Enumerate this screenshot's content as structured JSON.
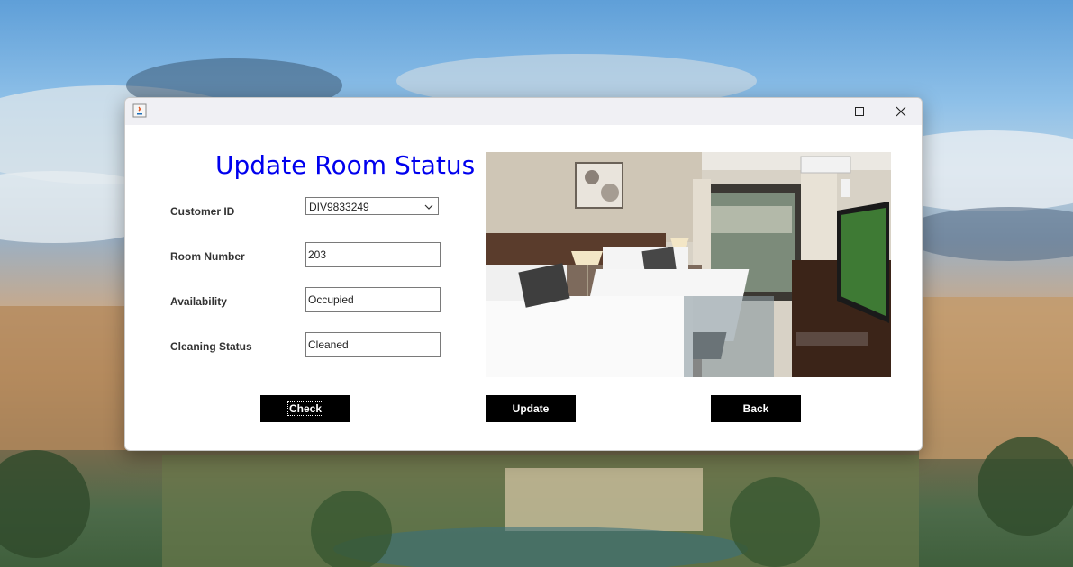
{
  "window": {
    "title": ""
  },
  "form": {
    "title": "Update Room Status",
    "customer_id": {
      "label": "Customer ID",
      "selected": "DIV9833249"
    },
    "room_number": {
      "label": "Room Number",
      "value": "203"
    },
    "availability": {
      "label": "Availability",
      "value": "Occupied"
    },
    "cleaning_status": {
      "label": "Cleaning Status",
      "value": "Cleaned"
    }
  },
  "buttons": {
    "check": "Check",
    "update": "Update",
    "back": "Back"
  },
  "colors": {
    "title": "#0000ee",
    "button_bg": "#000000",
    "button_text": "#ffffff"
  },
  "icons": [
    "java-app-icon",
    "minimize-icon",
    "maximize-icon",
    "close-icon",
    "chevron-down-icon"
  ]
}
